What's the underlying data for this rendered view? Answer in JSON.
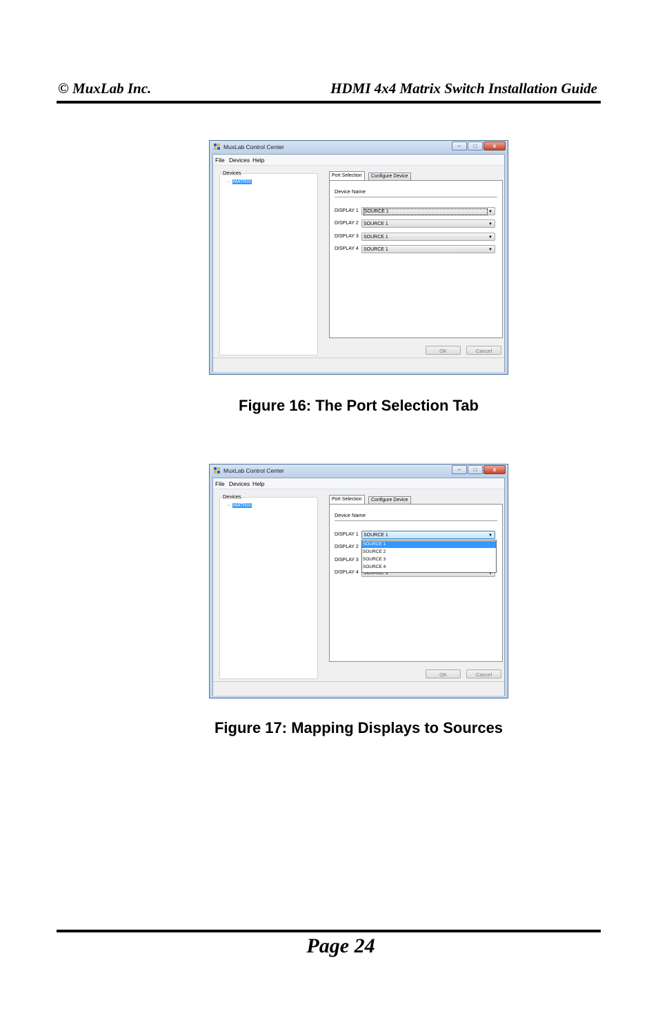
{
  "header": {
    "left": "© MuxLab Inc.",
    "right": "HDMI 4x4 Matrix Switch Installation Guide"
  },
  "figures": [
    {
      "caption": "Figure 16: The Port Selection Tab",
      "window": {
        "title": "MuxLab Control Center",
        "buttons": {
          "minimize": "–",
          "maximize": "□",
          "close": "x"
        },
        "menu": [
          "File",
          "Devices",
          "Help"
        ],
        "devices_label": "Devices",
        "tree_node": "MATRIX",
        "tabs": [
          "Port Selection",
          "Configure Device"
        ],
        "device_name_label": "Device Name",
        "rows": [
          {
            "label": "DISPLAY 1",
            "value": "SOURCE 1"
          },
          {
            "label": "DISPLAY 2",
            "value": "SOURCE 1"
          },
          {
            "label": "DISPLAY 3",
            "value": "SOURCE 1"
          },
          {
            "label": "DISPLAY 4",
            "value": "SOURCE 1"
          }
        ],
        "ok": "OK",
        "cancel": "Cancel"
      }
    },
    {
      "caption": "Figure 17: Mapping Displays to Sources",
      "window": {
        "title": "MuxLab Control Center",
        "buttons": {
          "minimize": "–",
          "maximize": "□",
          "close": "x"
        },
        "menu": [
          "File",
          "Devices",
          "Help"
        ],
        "devices_label": "Devices",
        "tree_node": "MATRIX",
        "tabs": [
          "Port Selection",
          "Configure Device"
        ],
        "device_name_label": "Device Name",
        "rows": [
          {
            "label": "DISPLAY 1",
            "value": "SOURCE 1"
          },
          {
            "label": "DISPLAY 2",
            "value": ""
          },
          {
            "label": "DISPLAY 3",
            "value": ""
          },
          {
            "label": "DISPLAY 4",
            "value": "SOURCE 1"
          }
        ],
        "dropdown_options": [
          "SOURCE 1",
          "SOURCE 2",
          "SOURCE 3",
          "SOURCE 4"
        ],
        "ok": "OK",
        "cancel": "Cancel"
      }
    }
  ],
  "footer": {
    "page": "Page 24"
  },
  "colors": {
    "selection": "#3399ff",
    "title_bar": "#c2d6ec",
    "close_button": "#c7452b"
  }
}
